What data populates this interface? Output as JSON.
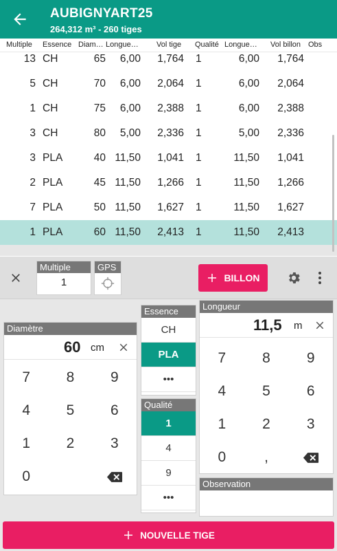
{
  "header": {
    "title": "AUBIGNYART25",
    "subtitle": "264,312 m³ - 260 tiges",
    "back_icon": "arrow-left-icon",
    "color": "#0a9a86"
  },
  "columns": [
    "Multiple",
    "Essence",
    "Diam…",
    "Longue…",
    "Vol tige",
    "Qualité",
    "Longue…",
    "Vol billon",
    "Obs"
  ],
  "rows": [
    {
      "multiple": "13",
      "essence": "CH",
      "diametre": "65",
      "longueur": "6,00",
      "vol_tige": "1,764",
      "qualite": "1",
      "longueur_billon": "6,00",
      "vol_billon": "1,764",
      "obs": ""
    },
    {
      "multiple": "5",
      "essence": "CH",
      "diametre": "70",
      "longueur": "6,00",
      "vol_tige": "2,064",
      "qualite": "1",
      "longueur_billon": "6,00",
      "vol_billon": "2,064",
      "obs": ""
    },
    {
      "multiple": "1",
      "essence": "CH",
      "diametre": "75",
      "longueur": "6,00",
      "vol_tige": "2,388",
      "qualite": "1",
      "longueur_billon": "6,00",
      "vol_billon": "2,388",
      "obs": ""
    },
    {
      "multiple": "3",
      "essence": "CH",
      "diametre": "80",
      "longueur": "5,00",
      "vol_tige": "2,336",
      "qualite": "1",
      "longueur_billon": "5,00",
      "vol_billon": "2,336",
      "obs": ""
    },
    {
      "multiple": "3",
      "essence": "PLA",
      "diametre": "40",
      "longueur": "11,50",
      "vol_tige": "1,041",
      "qualite": "1",
      "longueur_billon": "11,50",
      "vol_billon": "1,041",
      "obs": ""
    },
    {
      "multiple": "2",
      "essence": "PLA",
      "diametre": "45",
      "longueur": "11,50",
      "vol_tige": "1,266",
      "qualite": "1",
      "longueur_billon": "11,50",
      "vol_billon": "1,266",
      "obs": ""
    },
    {
      "multiple": "7",
      "essence": "PLA",
      "diametre": "50",
      "longueur": "11,50",
      "vol_tige": "1,627",
      "qualite": "1",
      "longueur_billon": "11,50",
      "vol_billon": "1,627",
      "obs": ""
    },
    {
      "multiple": "1",
      "essence": "PLA",
      "diametre": "60",
      "longueur": "11,50",
      "vol_tige": "2,413",
      "qualite": "1",
      "longueur_billon": "11,50",
      "vol_billon": "2,413",
      "obs": "",
      "selected": true
    }
  ],
  "toolbar": {
    "close_icon": "close-icon",
    "multiple_label": "Multiple",
    "multiple_value": "1",
    "gps_label": "GPS",
    "gps_icon": "crosshair-icon",
    "billon_label": "BILLON",
    "accent": "#e91e63",
    "settings_icon": "gear-icon",
    "menu_icon": "more-vert-icon"
  },
  "diametre": {
    "label": "Diamètre",
    "value": "60",
    "unit": "cm",
    "keys": [
      "7",
      "8",
      "9",
      "4",
      "5",
      "6",
      "1",
      "2",
      "3",
      "0",
      "",
      ""
    ]
  },
  "essence": {
    "label": "Essence",
    "options": [
      "CH",
      "PLA",
      "•••"
    ],
    "selected": "PLA"
  },
  "qualite": {
    "label": "Qualité",
    "options": [
      "1",
      "4",
      "9",
      "•••"
    ],
    "selected": "1"
  },
  "longueur": {
    "label": "Longueur",
    "value": "11,5",
    "unit": "m",
    "keys": [
      "7",
      "8",
      "9",
      "4",
      "5",
      "6",
      "1",
      "2",
      "3",
      "0",
      ",",
      ""
    ]
  },
  "observation": {
    "label": "Observation",
    "value": ""
  },
  "nouvelle_tige_label": "NOUVELLE TIGE"
}
